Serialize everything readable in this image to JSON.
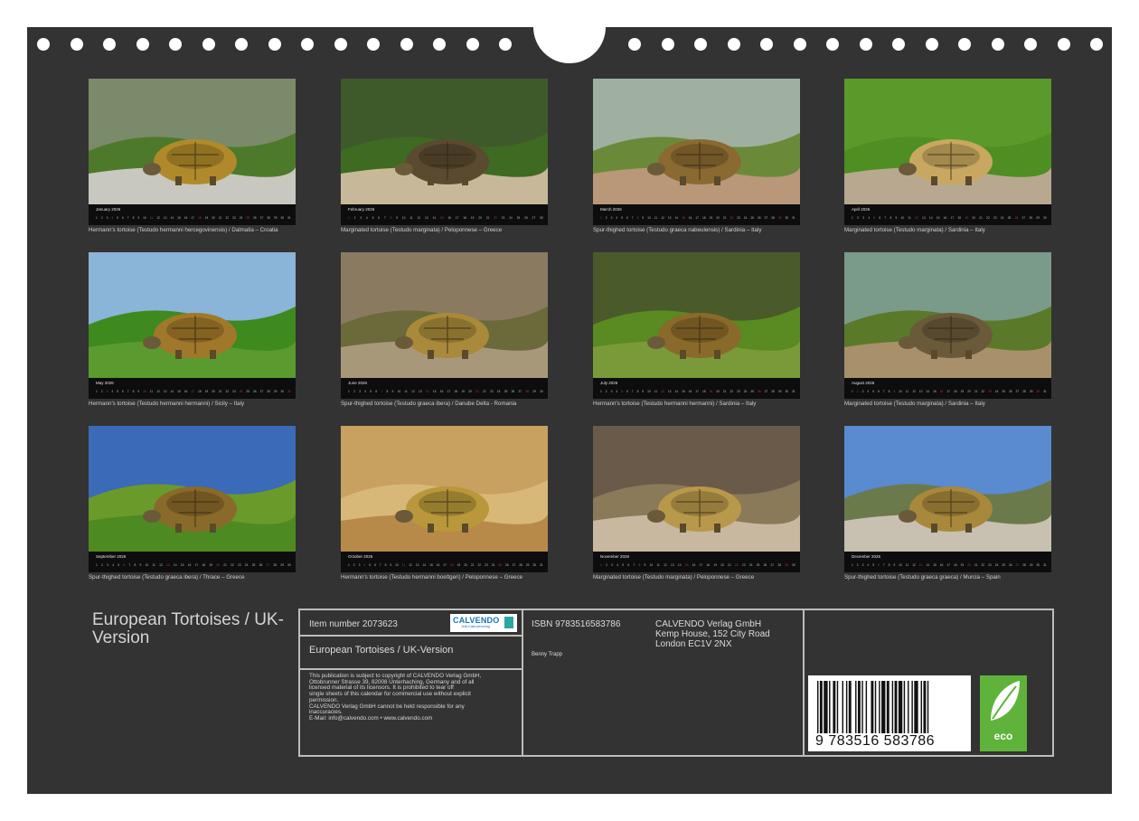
{
  "months": [
    {
      "label": "January 2026",
      "caption": "Hermann's tortoise (Testudo hermanni hercegovinensis) / Dalmatia – Croatia",
      "sky": "#7a8a6a",
      "ground": "#c8c8c0",
      "veg": "#4c7a2a",
      "shell": "#b08a2a"
    },
    {
      "label": "February 2026",
      "caption": "Marginated tortoise (Testudo marginata) / Peloponnese – Greece",
      "sky": "#3f5a2a",
      "ground": "#c8b89a",
      "veg": "#3e6a22",
      "shell": "#5a4a30"
    },
    {
      "label": "March 2026",
      "caption": "Spur-thighed tortoise (Testudo graeca nabeulensis) / Sardinia – Italy",
      "sky": "#9fb0a0",
      "ground": "#b89878",
      "veg": "#6a8a3a",
      "shell": "#8a6a30"
    },
    {
      "label": "April 2026",
      "caption": "Marginated tortoise (Testudo marginata) / Sardinia – Italy",
      "sky": "#5a9a2a",
      "ground": "#b8a890",
      "veg": "#4e8e22",
      "shell": "#c8a860"
    },
    {
      "label": "May 2026",
      "caption": "Hermann's tortoise (Testudo hermanni hermanni) / Sicily – Italy",
      "sky": "#8ab4d8",
      "ground": "#5a9a2e",
      "veg": "#3e8a1e",
      "shell": "#a0782a"
    },
    {
      "label": "June 2026",
      "caption": "Spur-thighed tortoise (Testudo graeca ibera) / Danube Delta - Romania",
      "sky": "#8a7a60",
      "ground": "#a8987a",
      "veg": "#6a6a3a",
      "shell": "#a88a3a"
    },
    {
      "label": "July 2026",
      "caption": "Hermann's tortoise (Testudo hermanni hermanni) / Sardinia – Italy",
      "sky": "#4a5a2a",
      "ground": "#7a9a3a",
      "veg": "#5a8a22",
      "shell": "#8a6a2a"
    },
    {
      "label": "August 2026",
      "caption": "Marginated tortoise (Testudo marginata) / Sardinia – Italy",
      "sky": "#7a9a8a",
      "ground": "#a8906a",
      "veg": "#5a7a2a",
      "shell": "#6a5a3a"
    },
    {
      "label": "September 2026",
      "caption": "Spur-thighed tortoise (Testudo graeca ibera) / Thrace – Greece",
      "sky": "#3a6ab8",
      "ground": "#4e8a22",
      "veg": "#6a9a2a",
      "shell": "#8a6a2a"
    },
    {
      "label": "October 2026",
      "caption": "Hermann's tortoise (Testudo hermanni boettgeri) / Peloponnese – Greece",
      "sky": "#c8a060",
      "ground": "#b88a4a",
      "veg": "#d8b878",
      "shell": "#b8983a"
    },
    {
      "label": "November 2026",
      "caption": "Marginated tortoise (Testudo marginata) / Peloponnese – Greece",
      "sky": "#6a5a4a",
      "ground": "#c8b8a0",
      "veg": "#8a7a5a",
      "shell": "#b8984a"
    },
    {
      "label": "December 2026",
      "caption": "Spur-thighed tortoise (Testudo graeca graeca) / Murcia – Spain",
      "sky": "#5a8ad0",
      "ground": "#c8c0b0",
      "veg": "#6a7a4a",
      "shell": "#a8883a"
    }
  ],
  "title": "European Tortoises / UK-Version",
  "info": {
    "item_number": "Item number 2073623",
    "logo_brand": "CALVENDO",
    "logo_tag": "Jetzt Kalenderverlag",
    "subtitle": "European Tortoises / UK-Version",
    "legal": [
      "This publication is subject to copyright of CALVENDO Verlag GmbH,",
      "Ottobrunner Strasse 39, 82008 Unterhaching, Germany and of all",
      "licensed material of its licensors. It is prohibited to tear off",
      "single sheets of this calendar for commercial use without explicit",
      "permission.",
      "CALVENDO Verlag GmbH cannot be held responsible for any",
      "inaccuracies.",
      "E-Mail: info@calvendo.com • www.calvendo.com"
    ],
    "isbn": "ISBN 9783516583786",
    "author": "Benny Trapp",
    "publisher": [
      "CALVENDO Verlag GmbH",
      "Kemp House, 152 City Road",
      "London EC1V 2NX"
    ],
    "barcode_number": "9   783516   583786",
    "eco_label": "eco"
  }
}
